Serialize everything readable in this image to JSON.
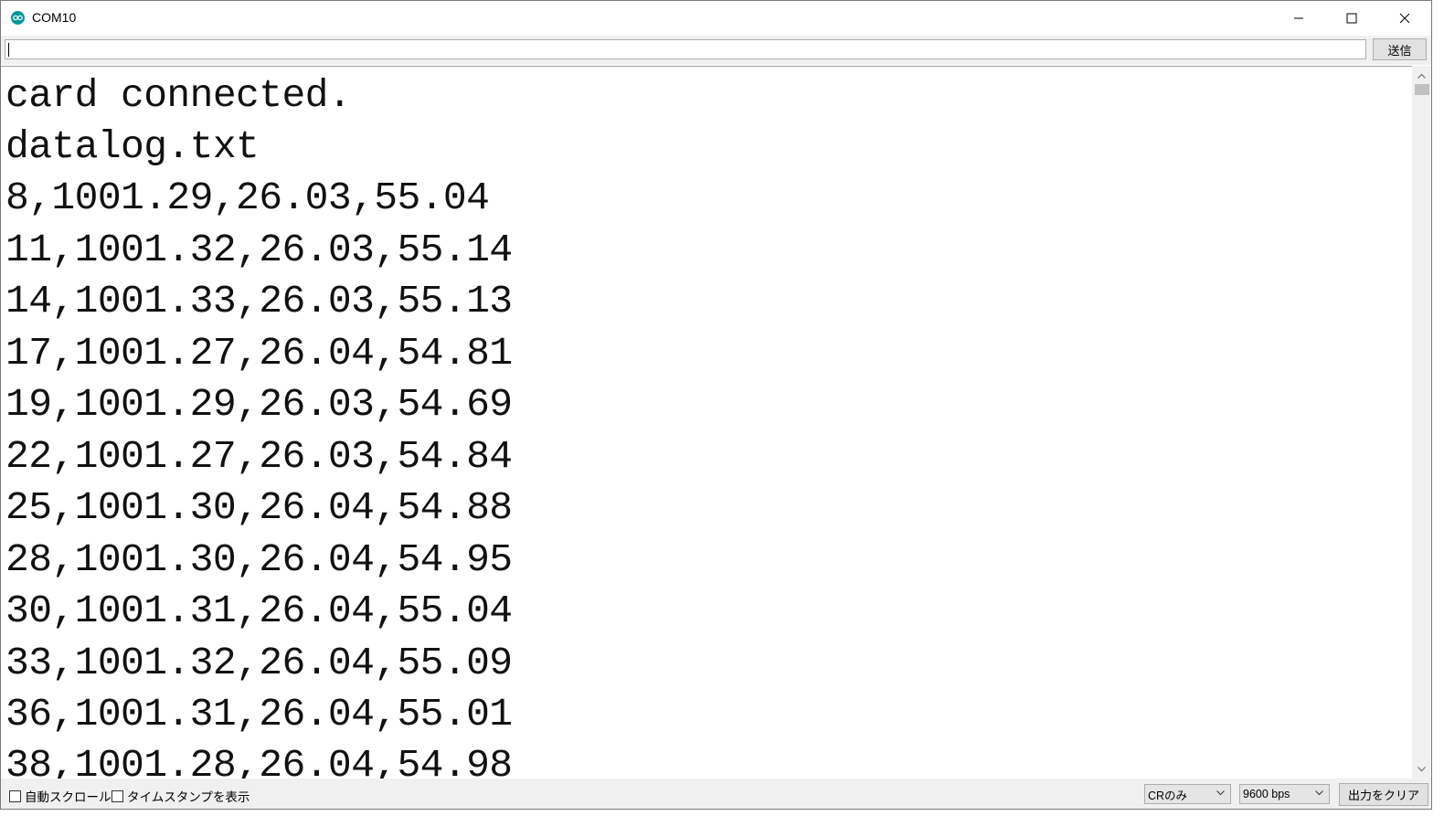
{
  "window": {
    "title": "COM10",
    "icon": "arduino-icon",
    "controls": [
      "minimize-icon",
      "maximize-icon",
      "close-icon"
    ]
  },
  "send_bar": {
    "input_value": "",
    "send_label": "送信"
  },
  "output": {
    "lines": [
      "card connected.",
      "datalog.txt",
      "8,1001.29,26.03,55.04",
      "11,1001.32,26.03,55.14",
      "14,1001.33,26.03,55.13",
      "17,1001.27,26.04,54.81",
      "19,1001.29,26.03,54.69",
      "22,1001.27,26.03,54.84",
      "25,1001.30,26.04,54.88",
      "28,1001.30,26.04,54.95",
      "30,1001.31,26.04,55.04",
      "33,1001.32,26.04,55.09",
      "36,1001.31,26.04,55.01",
      "38,1001.28,26.04,54.98"
    ]
  },
  "bottom_bar": {
    "autoscroll_label": "自動スクロール",
    "autoscroll_checked": false,
    "timestamp_label": "タイムスタンプを表示",
    "timestamp_checked": false,
    "line_ending_value": "CRのみ",
    "baud_value": "9600 bps",
    "clear_label": "出力をクリア"
  },
  "colors": {
    "arduino_teal": "#00979c",
    "toolbar_bg": "#f0f0f0"
  }
}
